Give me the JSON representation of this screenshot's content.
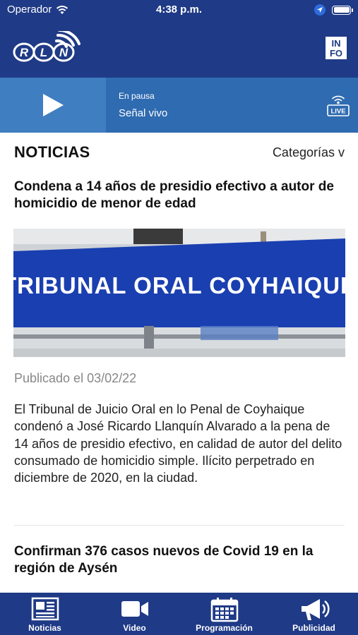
{
  "status_bar": {
    "carrier": "Operador",
    "time": "4:38 p.m."
  },
  "header": {
    "logo_text": "RLN",
    "info_button": "INFO"
  },
  "player": {
    "state": "En pausa",
    "title": "Señal vivo",
    "live_label": "LIVE"
  },
  "section": {
    "title": "NOTICIAS",
    "categories_label": "Categorías v"
  },
  "articles": [
    {
      "title": "Condena a 14 años de presidio efectivo a autor de homicidio de menor de edad",
      "image_sign_text": "TRIBUNAL ORAL COYHAIQUE",
      "date": "Publicado el 03/02/22",
      "body": "El Tribunal de Juicio Oral en lo Penal de Coyhaique condenó a José Ricardo Llanquín Alvarado a la pena de 14 años de presidio efectivo, en calidad de autor del delito consumado de homicidio simple. Ilícito perpetrado en diciembre de 2020, en la ciudad."
    },
    {
      "title": "Confirman 376 casos nuevos de Covid 19 en la región de Aysén"
    }
  ],
  "tabs": [
    {
      "label": "Noticias",
      "icon": "newspaper-icon"
    },
    {
      "label": "Video",
      "icon": "video-camera-icon"
    },
    {
      "label": "Programación",
      "icon": "calendar-icon"
    },
    {
      "label": "Publicidad",
      "icon": "megaphone-icon"
    }
  ],
  "colors": {
    "brand_navy": "#1f3a86",
    "player_blue": "#2f6bb0",
    "sign_blue": "#1a3fb0"
  }
}
